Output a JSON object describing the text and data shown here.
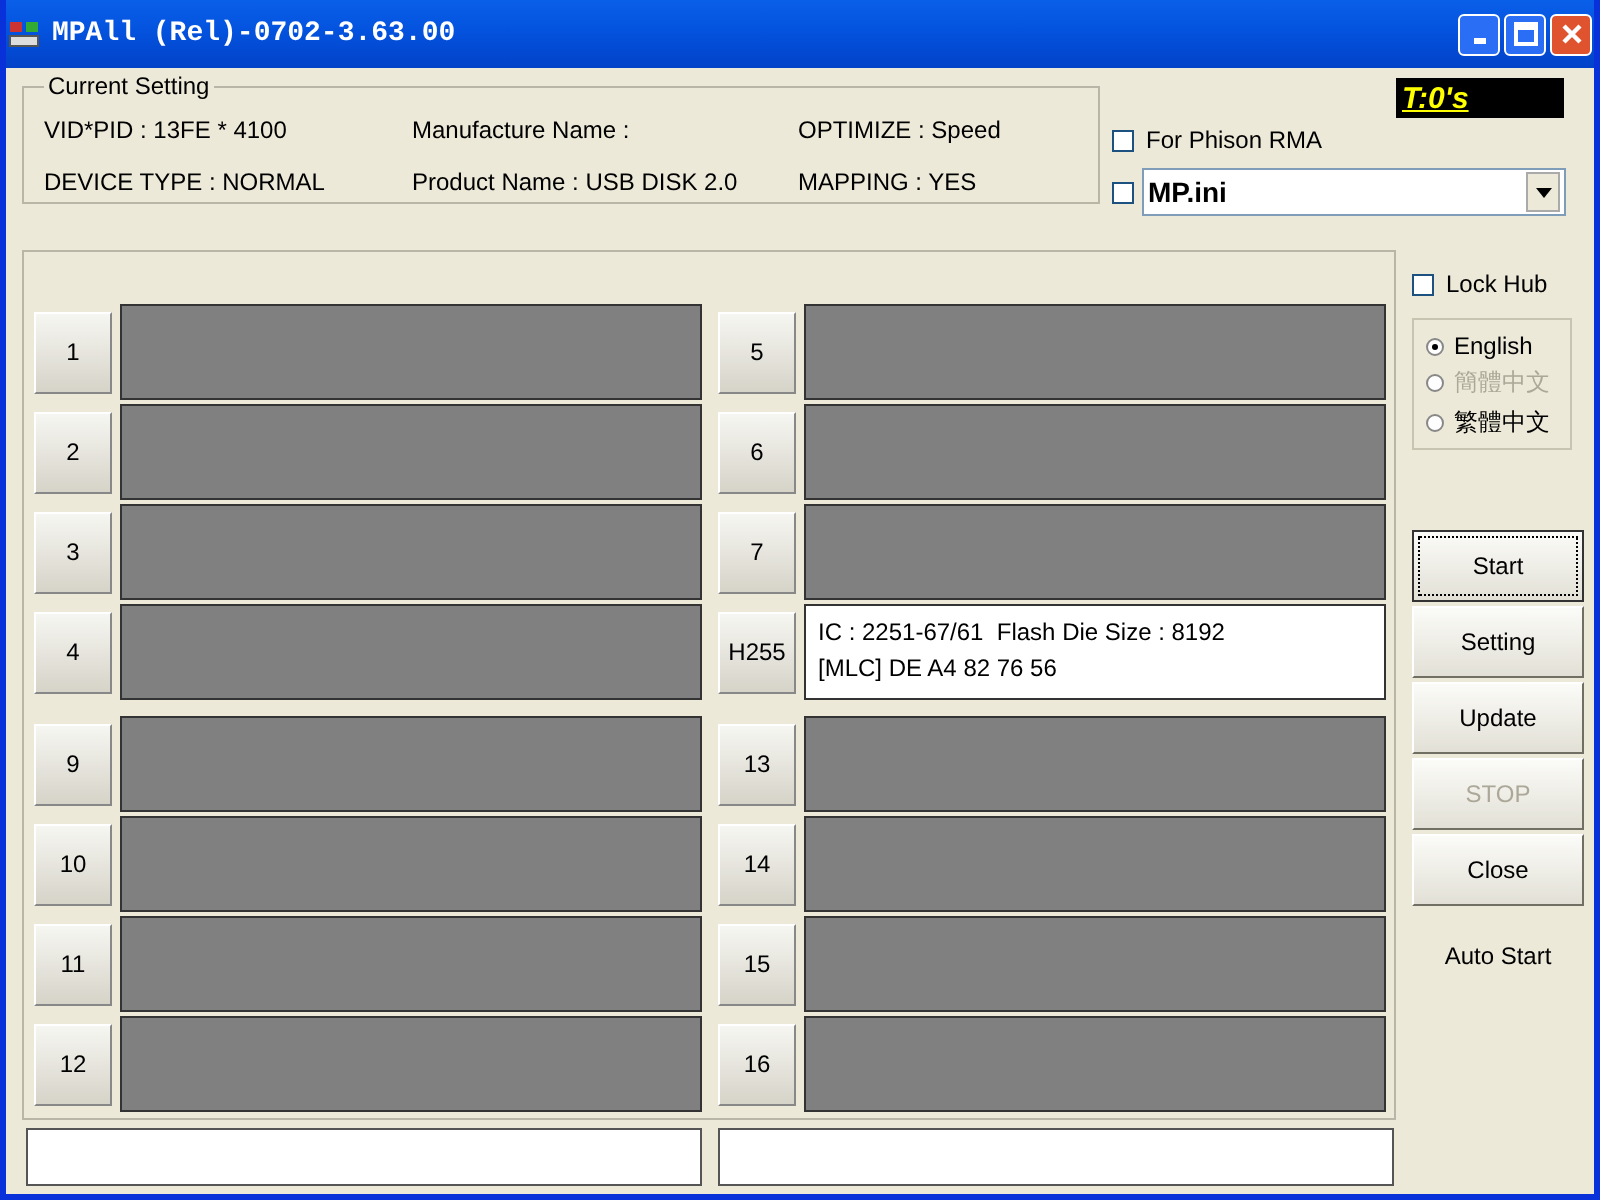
{
  "window": {
    "title": "MPAll (Rel)-0702-3.63.00"
  },
  "current_setting": {
    "title": "Current Setting",
    "items": [
      "VID*PID : 13FE * 4100",
      "Manufacture Name :",
      "OPTIMIZE : Speed",
      "DEVICE TYPE : NORMAL",
      "Product Name : USB DISK 2.0",
      "MAPPING : YES"
    ]
  },
  "timer": "T:0's",
  "for_phison_rma": {
    "label": "For Phison RMA",
    "checked": false
  },
  "ini": {
    "checked": false,
    "value": "MP.ini"
  },
  "columns": [
    {
      "groups": [
        [
          {
            "port": "1"
          },
          {
            "port": "2"
          },
          {
            "port": "3"
          },
          {
            "port": "4"
          }
        ],
        [
          {
            "port": "9"
          },
          {
            "port": "10"
          },
          {
            "port": "11"
          },
          {
            "port": "12"
          }
        ]
      ]
    },
    {
      "groups": [
        [
          {
            "port": "5"
          },
          {
            "port": "6"
          },
          {
            "port": "7"
          },
          {
            "port": "H255",
            "lines": [
              "IC : 2251-67/61  Flash Die Size : 8192",
              "[MLC] DE A4 82 76 56"
            ]
          }
        ],
        [
          {
            "port": "13"
          },
          {
            "port": "14"
          },
          {
            "port": "15"
          },
          {
            "port": "16"
          }
        ]
      ]
    }
  ],
  "lock_hub": {
    "label": "Lock Hub",
    "checked": false
  },
  "languages": [
    {
      "label": "English",
      "selected": true,
      "disabled": false
    },
    {
      "label": "簡體中文",
      "selected": false,
      "disabled": true
    },
    {
      "label": "繁體中文",
      "selected": false,
      "disabled": false
    }
  ],
  "buttons": [
    {
      "label": "Start",
      "disabled": false,
      "focused": true
    },
    {
      "label": "Setting",
      "disabled": false,
      "focused": false
    },
    {
      "label": "Update",
      "disabled": false,
      "focused": false
    },
    {
      "label": "STOP",
      "disabled": true,
      "focused": false
    },
    {
      "label": "Close",
      "disabled": false,
      "focused": false
    }
  ],
  "auto_start": "Auto Start"
}
